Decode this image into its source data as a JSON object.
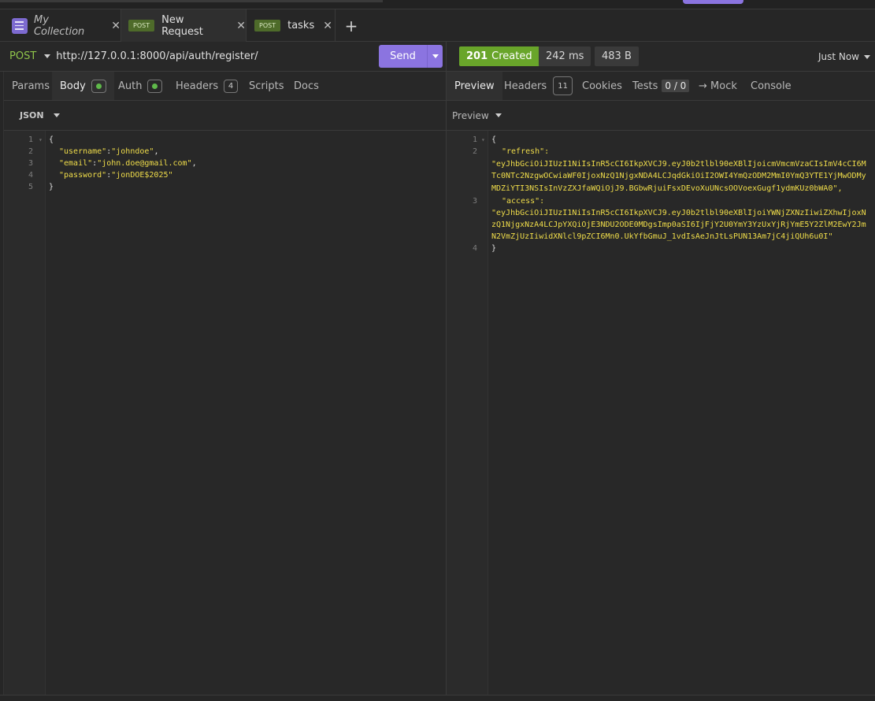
{
  "tabs": {
    "collection": {
      "label": "My Collection",
      "icon": "menu-icon",
      "close": "✕"
    },
    "active": {
      "method": "POST",
      "label": "New Request",
      "close": "✕"
    },
    "tasks": {
      "method": "POST",
      "label": "tasks",
      "close": "✕"
    },
    "add": "+"
  },
  "request": {
    "method": "POST",
    "url": "http://127.0.0.1:8000/api/auth/register/",
    "send_label": "Send",
    "tabs": [
      {
        "label": "Params"
      },
      {
        "label": "Body",
        "indicator": "green-dot"
      },
      {
        "label": "Auth",
        "indicator": "green-dot"
      },
      {
        "label": "Headers",
        "count": "4"
      },
      {
        "label": "Scripts"
      },
      {
        "label": "Docs"
      }
    ],
    "body_format": "JSON",
    "body_lines": [
      {
        "n": "1",
        "text": "{"
      },
      {
        "n": "2",
        "key": "\"username\"",
        "sep": ":",
        "val": "\"johndoe\"",
        "end": ","
      },
      {
        "n": "3",
        "key": "\"email\"",
        "sep": ":",
        "val": "\"john.doe@gmail.com\"",
        "end": ","
      },
      {
        "n": "4",
        "key": "\"password\"",
        "sep": ":",
        "val": "\"jonDOE$2025\"",
        "end": ""
      },
      {
        "n": "5",
        "text": "}"
      }
    ]
  },
  "response": {
    "status_code": "201",
    "status_text": "Created",
    "time": "242 ms",
    "size": "483 B",
    "when": "Just Now",
    "tabs": [
      {
        "label": "Preview"
      },
      {
        "label": "Headers",
        "count": "11"
      },
      {
        "label": "Cookies"
      },
      {
        "label": "Tests",
        "value": "0 / 0"
      },
      {
        "label": "→ Mock"
      },
      {
        "label": "Console"
      }
    ],
    "preview_format": "Preview",
    "line_numbers": [
      "1",
      "2",
      "3",
      "4"
    ],
    "open_brace": "{",
    "close_brace": "}",
    "refresh_key": "\"refresh\":",
    "refresh_value_lines": [
      "\"eyJhbGciOiJIUzI1NiIsInR5cCI6IkpXVCJ9.eyJ0b2tlbl90eXBlIjoicmVmcmVzaCIsImV4cCI6M",
      "Tc0NTc2NzgwOCwiaWF0IjoxNzQ1NjgxNDA4LCJqdGkiOiI2OWI4YmQzODM2MmI0YmQ3YTE1YjMwODMy",
      "MDZiYTI3NSIsInVzZXJfaWQiOjJ9.BGbwRjuiFsxDEvoXuUNcsOOVoexGugf1ydmKUz0bWA0\","
    ],
    "access_key": "\"access\":",
    "access_value_lines": [
      "\"eyJhbGciOiJIUzI1NiIsInR5cCI6IkpXVCJ9.eyJ0b2tlbl90eXBlIjoiYWNjZXNzIiwiZXhwIjoxN",
      "zQ1NjgxNzA4LCJpYXQiOjE3NDU2ODE0MDgsImp0aSI6IjFjY2U0YmY3YzUxYjRjYmE5Y2ZlM2EwY2Jm",
      "N2VmZjUzIiwidXNlcl9pZCI6Mn0.UkYfbGmuJ_1vdIsAeJnJtLsPUN13Am7jC4jiQUh6u0I\""
    ]
  }
}
